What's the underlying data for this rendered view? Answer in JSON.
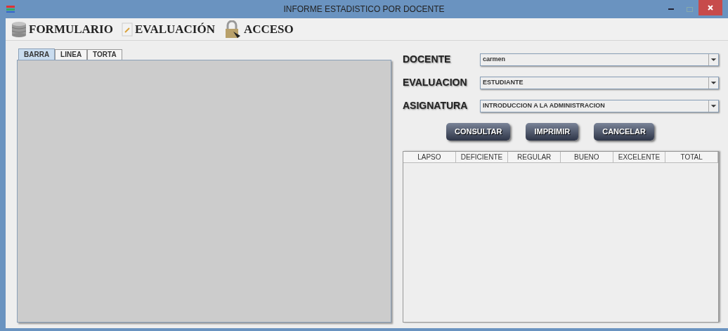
{
  "window": {
    "title": "INFORME ESTADISTICO POR DOCENTE"
  },
  "menu": [
    {
      "label": "FORMULARIO",
      "kind": "database"
    },
    {
      "label": "EVALUACIÓN",
      "kind": "note"
    },
    {
      "label": "ACCESO",
      "kind": "lock"
    }
  ],
  "tabs": [
    {
      "label": "BARRA",
      "selected": true
    },
    {
      "label": "LINEA",
      "selected": false
    },
    {
      "label": "TORTA",
      "selected": false
    }
  ],
  "fields": [
    {
      "label": "DOCENTE",
      "value": "carmen"
    },
    {
      "label": "EVALUACION",
      "value": "ESTUDIANTE"
    },
    {
      "label": "ASIGNATURA",
      "value": "INTRODUCCION A LA ADMINISTRACION"
    }
  ],
  "buttons": [
    "CONSULTAR",
    "IMPRIMIR",
    "CANCELAR"
  ],
  "table": {
    "columns": [
      "LAPSO",
      "DEFICIENTE",
      "REGULAR",
      "BUENO",
      "EXCELENTE",
      "TOTAL"
    ]
  }
}
